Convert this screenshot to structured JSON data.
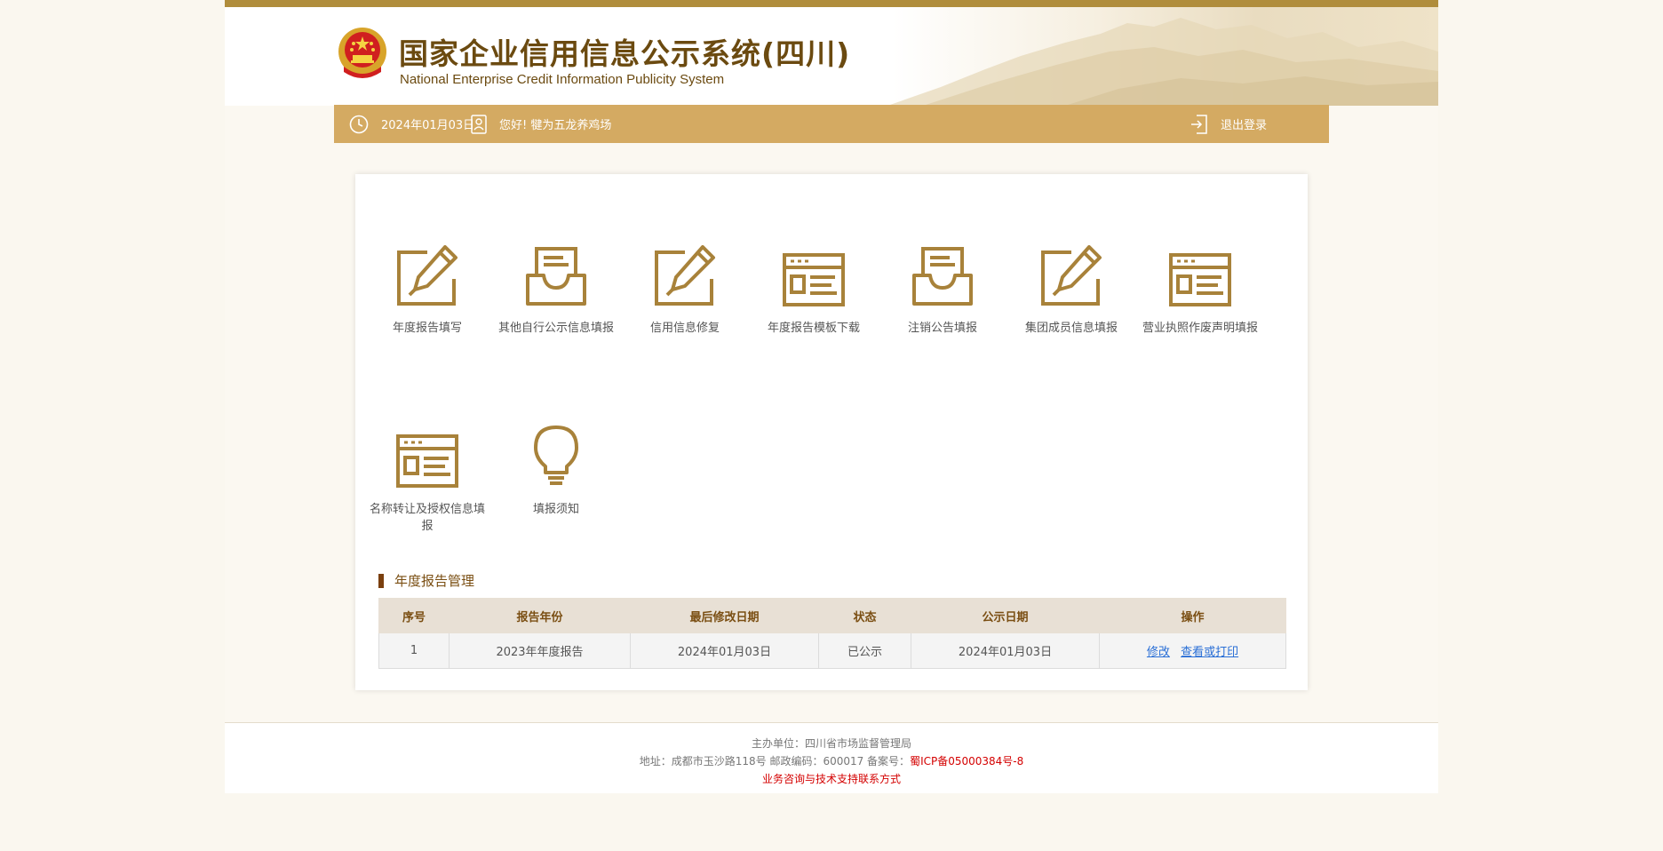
{
  "header": {
    "title_cn": "国家企业信用信息公示系统(四川)",
    "title_en": "National Enterprise Credit Information Publicity System"
  },
  "nav": {
    "date": "2024年01月03日",
    "greeting": "您好!  犍为五龙养鸡场",
    "logout": "退出登录"
  },
  "tiles": [
    {
      "label": "年度报告填写",
      "icon": "edit-pencil-icon"
    },
    {
      "label": "其他自行公示信息填报",
      "icon": "inbox-document-icon"
    },
    {
      "label": "信用信息修复",
      "icon": "edit-pencil-icon"
    },
    {
      "label": "年度报告模板下载",
      "icon": "window-list-icon"
    },
    {
      "label": "注销公告填报",
      "icon": "inbox-document-icon"
    },
    {
      "label": "集团成员信息填报",
      "icon": "edit-pencil-icon"
    },
    {
      "label": "营业执照作废声明填报",
      "icon": "window-list-icon"
    },
    {
      "label": "名称转让及授权信息填报",
      "icon": "window-list-icon"
    },
    {
      "label": "填报须知",
      "icon": "lightbulb-icon"
    }
  ],
  "report_section": {
    "title": "年度报告管理",
    "columns": [
      "序号",
      "报告年份",
      "最后修改日期",
      "状态",
      "公示日期",
      "操作"
    ],
    "rows": [
      {
        "index": "1",
        "year": "2023年年度报告",
        "modified": "2024年01月03日",
        "status": "已公示",
        "published": "2024年01月03日",
        "action_edit": "修改",
        "action_view": "查看或打印"
      }
    ]
  },
  "footer": {
    "sponsor": "主办单位：四川省市场监督管理局",
    "address": "地址：成都市玉沙路118号 邮政编码：600017 备案号：",
    "icp": "蜀ICP备05000384号-8",
    "support": "业务咨询与技术支持联系方式"
  },
  "colors": {
    "gold": "#b08d3c",
    "nav_bg": "#d4aa62",
    "brown_text": "#7a4e12",
    "icon_gold": "#a8823a",
    "link_blue": "#2a6fd6",
    "alert_red": "#d40000"
  }
}
